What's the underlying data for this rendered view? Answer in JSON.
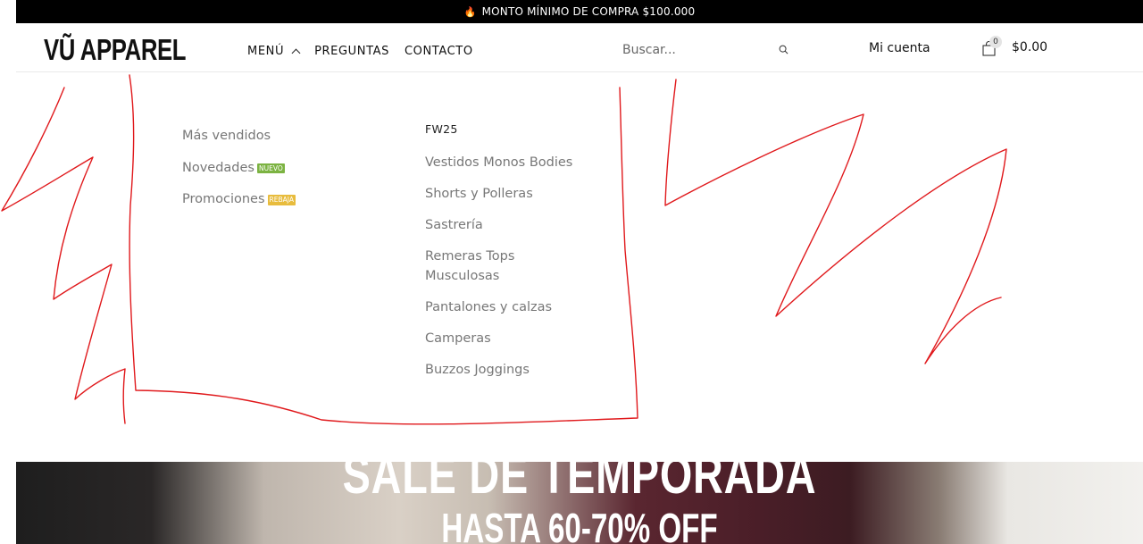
{
  "announcement": {
    "fire_icon": "🔥",
    "text": "MONTO MÍNIMO DE COMPRA $100.000"
  },
  "header": {
    "logo": "VŨ APPAREL",
    "nav": {
      "menu": "MENÚ",
      "preguntas": "PREGUNTAS",
      "contacto": "CONTACTO"
    },
    "search": {
      "placeholder": "Buscar..."
    },
    "account": "Mi cuenta",
    "cart": {
      "count": "0",
      "total": "$0.00"
    }
  },
  "mega_menu": {
    "column1": [
      {
        "label": "Más vendidos",
        "badge": ""
      },
      {
        "label": "Novedades",
        "badge": "NUEVO"
      },
      {
        "label": "Promociones",
        "badge": "REBAJA"
      }
    ],
    "column2": {
      "heading": "FW25",
      "items": [
        "Vestidos Monos Bodies",
        "Shorts y Polleras",
        "Sastrería",
        "Remeras Tops Musculosas",
        "Pantalones y calzas",
        "Camperas",
        "Buzzos Joggings"
      ]
    }
  },
  "hero": {
    "title": "SALE DE TEMPORADA",
    "subtitle": "HASTA 60-70% OFF"
  },
  "colors": {
    "annotation_stroke": "#e0191c",
    "badge_nuevo": "#7cb342",
    "badge_rebaja": "#e8bc3d"
  }
}
